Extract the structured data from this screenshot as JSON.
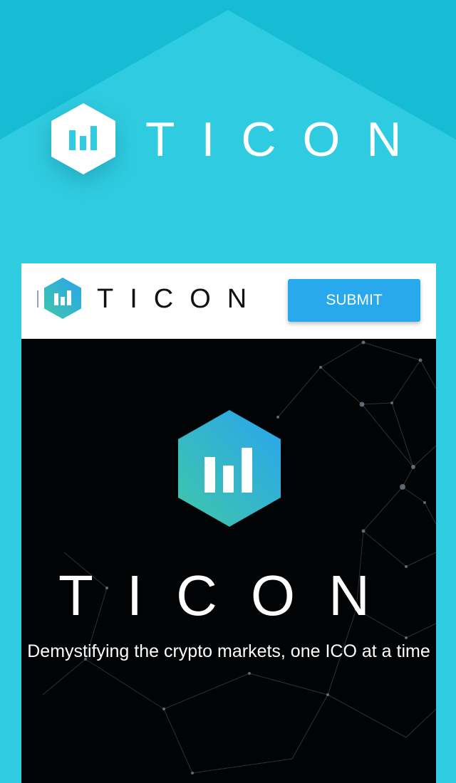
{
  "brand": {
    "name": "TICON",
    "colors": {
      "background": "#2fcbe0",
      "accent": "#28a9ee",
      "logo_gradient_start": "#3fc7a8",
      "logo_gradient_end": "#2aa4ee"
    }
  },
  "nav": {
    "brand_name": "TICON",
    "submit_label": "SUBMIT"
  },
  "hero": {
    "brand_name": "TICON",
    "tagline": "Demystifying the crypto markets, one ICO at a time"
  },
  "icons": {
    "logo": "bar-chart-hexagon-icon"
  }
}
